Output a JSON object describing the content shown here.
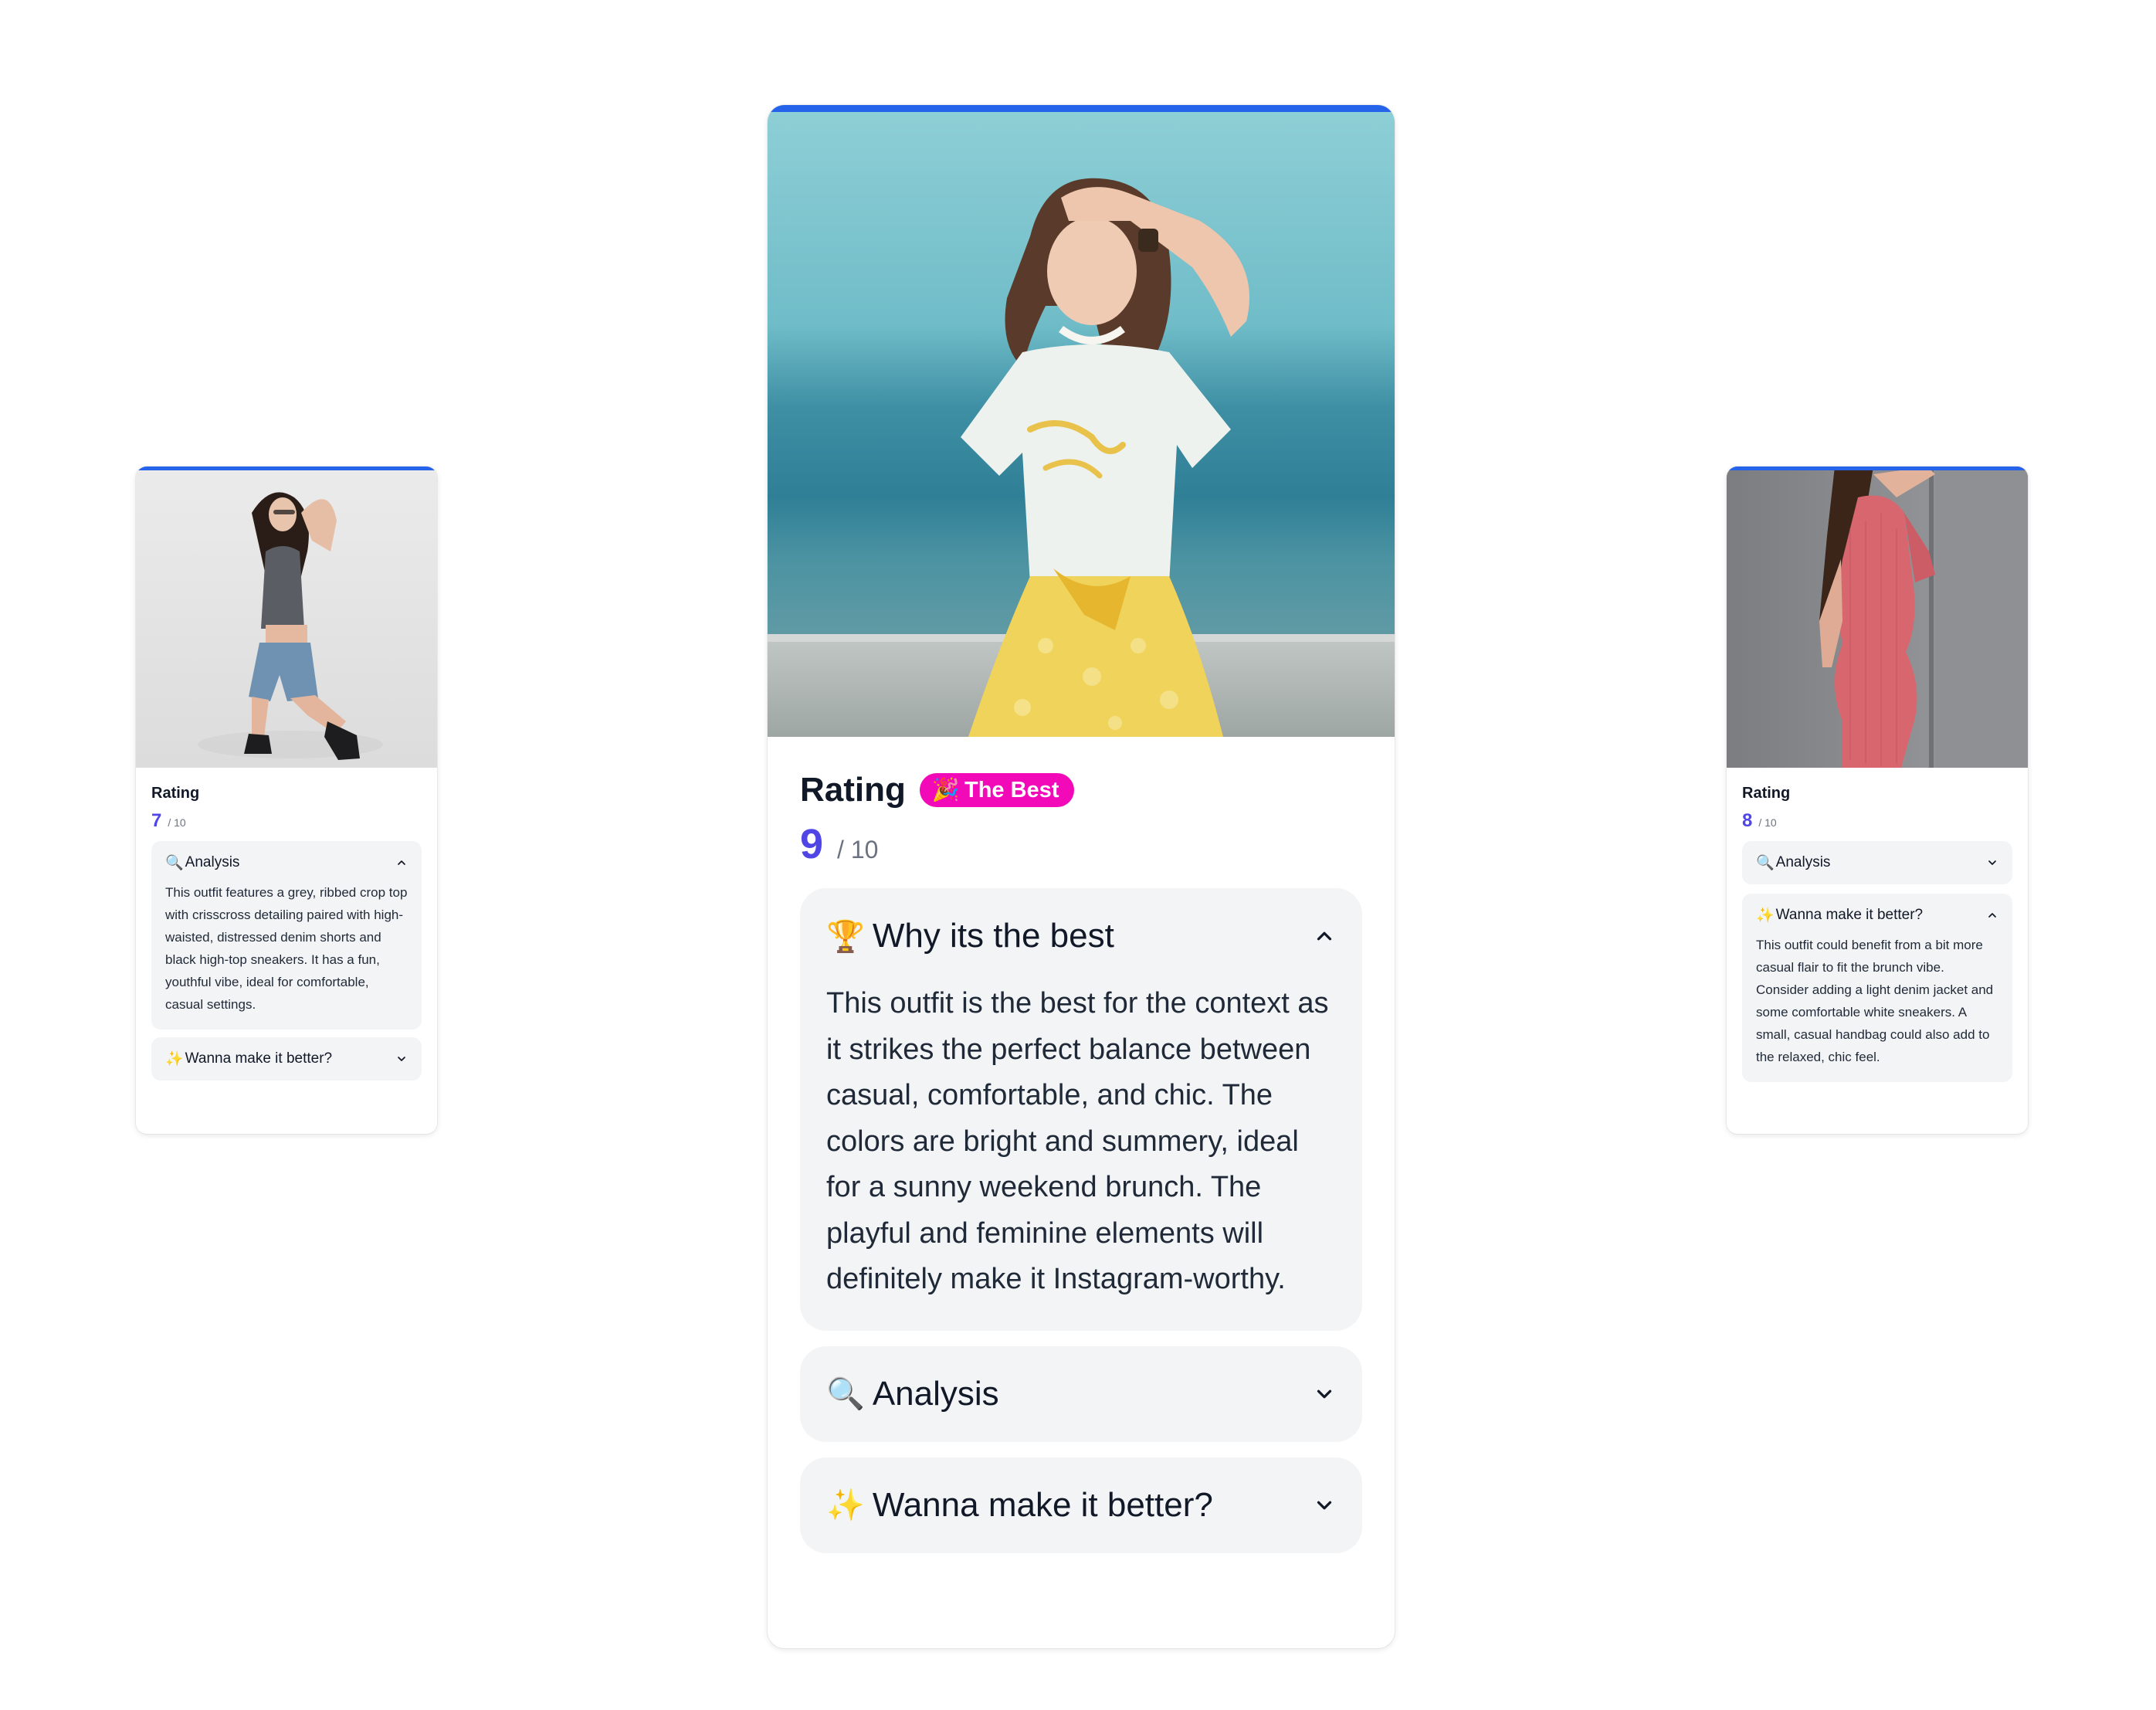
{
  "icons": {
    "magnifier": "🔍",
    "sparkles": "✨",
    "trophy": "🏆",
    "party": "🎉",
    "chevron_up": "chevron-up-icon",
    "chevron_down": "chevron-down-icon"
  },
  "colors": {
    "accent_bar": "#2563eb",
    "score": "#4f46e5",
    "badge_bg": "#f20ab8",
    "accordion_bg": "#f3f4f6"
  },
  "left_card": {
    "rating_label": "Rating",
    "score": "7",
    "score_max": "/ 10",
    "analysis": {
      "title": "Analysis",
      "expanded": true,
      "body": "This outfit features a grey, ribbed crop top with crisscross detailing paired with high-waisted, distressed denim shorts and black high-top sneakers. It has a fun, youthful vibe, ideal for comfortable, casual settings."
    },
    "improve": {
      "title": "Wanna make it better?",
      "expanded": false
    }
  },
  "center_card": {
    "rating_label": "Rating",
    "badge": "The Best",
    "score": "9",
    "score_max": "/ 10",
    "why": {
      "title": "Why its the best",
      "expanded": true,
      "body": "This outfit is the best for the context as it strikes the perfect balance between casual, comfortable, and chic. The colors are bright and summery, ideal for a sunny weekend brunch. The playful and feminine elements will definitely make it Instagram-worthy."
    },
    "analysis": {
      "title": "Analysis",
      "expanded": false
    },
    "improve": {
      "title": "Wanna make it better?",
      "expanded": false
    }
  },
  "right_card": {
    "rating_label": "Rating",
    "score": "8",
    "score_max": "/ 10",
    "analysis": {
      "title": "Analysis",
      "expanded": false
    },
    "improve": {
      "title": "Wanna make it better?",
      "expanded": true,
      "body": "This outfit could benefit from a bit more casual flair to fit the brunch vibe. Consider adding a light denim jacket and some comfortable white sneakers. A small, casual handbag could also add to the relaxed, chic feel."
    }
  }
}
